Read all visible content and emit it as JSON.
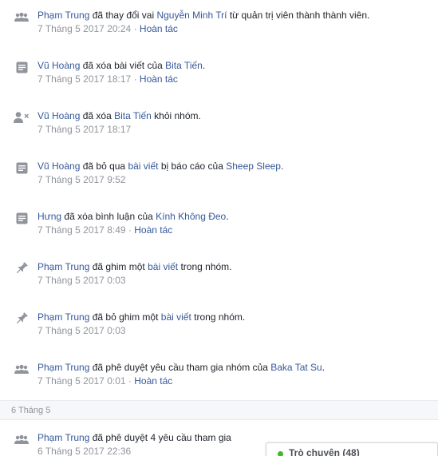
{
  "entries": [
    {
      "icon": "group-icon",
      "actor": "Phạm Trung",
      "t1": "đã thay đổi vai",
      "obj": "Nguyễn Minh Trí",
      "t2": "từ quản trị viên thành thành viên.",
      "obj2": "",
      "t3": "",
      "time": "7 Tháng 5 2017 20:24",
      "sep": "·",
      "undo": "Hoàn tác"
    },
    {
      "icon": "post-icon",
      "actor": "Vũ Hoàng",
      "t1": "đã xóa bài viết của",
      "obj": "Bita Tiến",
      "t2": ".",
      "obj2": "",
      "t3": "",
      "time": "7 Tháng 5 2017 18:17",
      "sep": "·",
      "undo": "Hoàn tác"
    },
    {
      "icon": "remove-user-icon",
      "actor": "Vũ Hoàng",
      "t1": "đã xóa",
      "obj": "Bita Tiến",
      "t2": "khỏi nhóm.",
      "obj2": "",
      "t3": "",
      "time": "7 Tháng 5 2017 18:17",
      "sep": "",
      "undo": ""
    },
    {
      "icon": "post-icon",
      "actor": "Vũ Hoàng",
      "t1": "đã bỏ qua",
      "obj": "bài viết",
      "t2": "bị báo cáo của",
      "obj2": "Sheep Sleep",
      "t3": ".",
      "time": "7 Tháng 5 2017 9:52",
      "sep": "",
      "undo": ""
    },
    {
      "icon": "post-icon",
      "actor": "Hưng",
      "t1": "đã xóa bình luận của",
      "obj": "Kính Không Đeo",
      "t2": ".",
      "obj2": "",
      "t3": "",
      "time": "7 Tháng 5 2017 8:49",
      "sep": "·",
      "undo": "Hoàn tác"
    },
    {
      "icon": "pin-icon",
      "actor": "Phạm Trung",
      "t1": "đã ghim một",
      "obj": "bài viết",
      "t2": "trong nhóm.",
      "obj2": "",
      "t3": "",
      "time": "7 Tháng 5 2017 0:03",
      "sep": "",
      "undo": ""
    },
    {
      "icon": "pin-icon",
      "actor": "Phạm Trung",
      "t1": "đã bỏ ghim một",
      "obj": "bài viết",
      "t2": "trong nhóm.",
      "obj2": "",
      "t3": "",
      "time": "7 Tháng 5 2017 0:03",
      "sep": "",
      "undo": ""
    },
    {
      "icon": "group-icon",
      "actor": "Phạm Trung",
      "t1": "đã phê duyệt yêu cầu tham gia nhóm của",
      "obj": "Baka Tat Su",
      "t2": ".",
      "obj2": "",
      "t3": "",
      "time": "7 Tháng 5 2017 0:01",
      "sep": "·",
      "undo": "Hoàn tác"
    }
  ],
  "day_header": "6 Tháng 5",
  "entries2": [
    {
      "icon": "group-icon",
      "actor": "Phạm Trung",
      "t1": "đã phê duyệt 4 yêu cầu tham gia",
      "obj": "",
      "t2": "",
      "obj2": "",
      "t3": "",
      "time": "6 Tháng 5 2017 22:36",
      "sep": "",
      "undo": ""
    }
  ],
  "chat": {
    "label": "Trò chuyện (48)",
    "status_color": "#42b72a"
  },
  "colors": {
    "link": "#365899",
    "meta": "#90949c",
    "icon": "#90949c"
  }
}
